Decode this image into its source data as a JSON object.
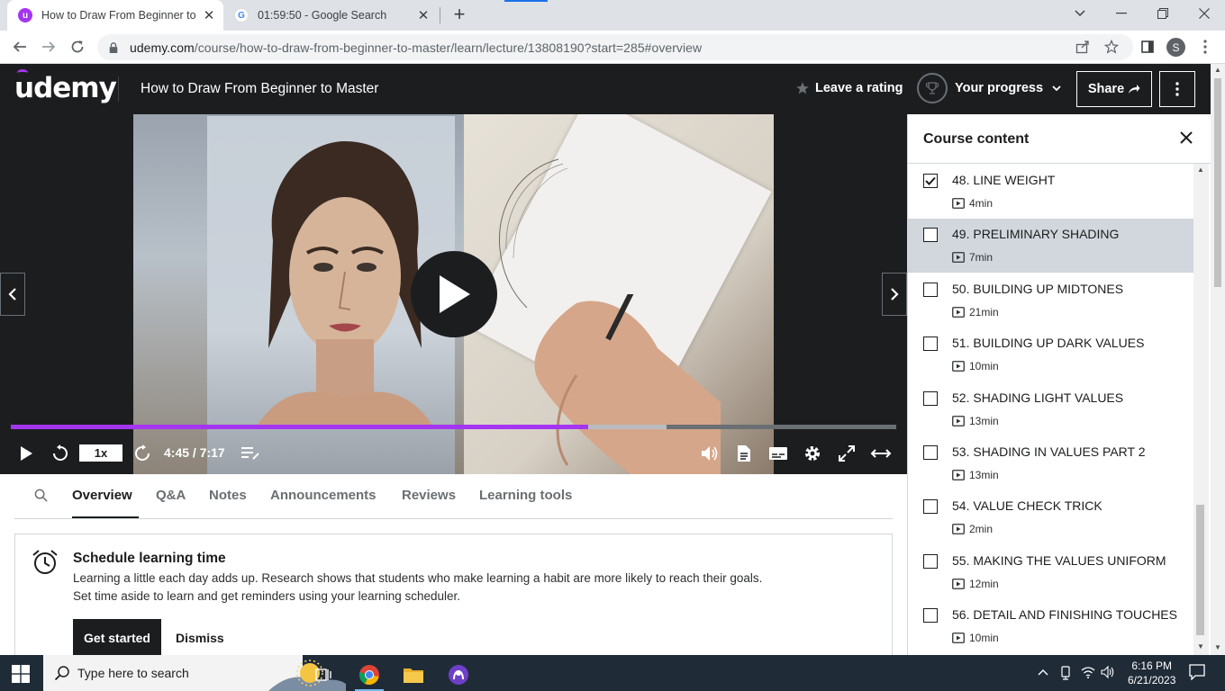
{
  "browser": {
    "tabs": [
      {
        "title": "How to Draw From Beginner to M",
        "active": true
      },
      {
        "title": "01:59:50 - Google Search",
        "active": false
      }
    ],
    "url_host": "udemy.com",
    "url_path": "/course/how-to-draw-from-beginner-to-master/learn/lecture/13808190?start=285#overview",
    "profile_initial": "S"
  },
  "header": {
    "logo": "udemy",
    "course_title": "How to Draw From Beginner to Master",
    "rating_label": "Leave a rating",
    "progress_label": "Your progress",
    "share_label": "Share"
  },
  "player": {
    "speed": "1x",
    "time": "4:45 / 7:17",
    "played_fraction": 0.652,
    "buffered_fraction": 0.741
  },
  "content_tabs": [
    "Overview",
    "Q&A",
    "Notes",
    "Announcements",
    "Reviews",
    "Learning tools"
  ],
  "schedule": {
    "title": "Schedule learning time",
    "line1": "Learning a little each day adds up. Research shows that students who make learning a habit are more likely to reach their goals.",
    "line2": "Set time aside to learn and get reminders using your learning scheduler.",
    "primary": "Get started",
    "secondary": "Dismiss"
  },
  "sidebar": {
    "title": "Course content",
    "lectures": [
      {
        "title": "48. LINE WEIGHT",
        "duration": "4min",
        "checked": true,
        "active": false
      },
      {
        "title": "49. PRELIMINARY SHADING",
        "duration": "7min",
        "checked": false,
        "active": true
      },
      {
        "title": "50. BUILDING UP MIDTONES",
        "duration": "21min",
        "checked": false,
        "active": false
      },
      {
        "title": "51. BUILDING UP DARK VALUES",
        "duration": "10min",
        "checked": false,
        "active": false
      },
      {
        "title": "52. SHADING LIGHT VALUES",
        "duration": "13min",
        "checked": false,
        "active": false
      },
      {
        "title": "53. SHADING IN VALUES PART 2",
        "duration": "13min",
        "checked": false,
        "active": false
      },
      {
        "title": "54. VALUE CHECK TRICK",
        "duration": "2min",
        "checked": false,
        "active": false
      },
      {
        "title": "55. MAKING THE VALUES UNIFORM",
        "duration": "12min",
        "checked": false,
        "active": false
      },
      {
        "title": "56. DETAIL AND FINISHING TOUCHES",
        "duration": "10min",
        "checked": false,
        "active": false
      }
    ]
  },
  "taskbar": {
    "search_placeholder": "Type here to search",
    "time": "6:16 PM",
    "date": "6/21/2023"
  },
  "colors": {
    "udemy_purple": "#a435f0",
    "udemy_dark": "#1c1d1f",
    "taskbar": "#202b38"
  }
}
